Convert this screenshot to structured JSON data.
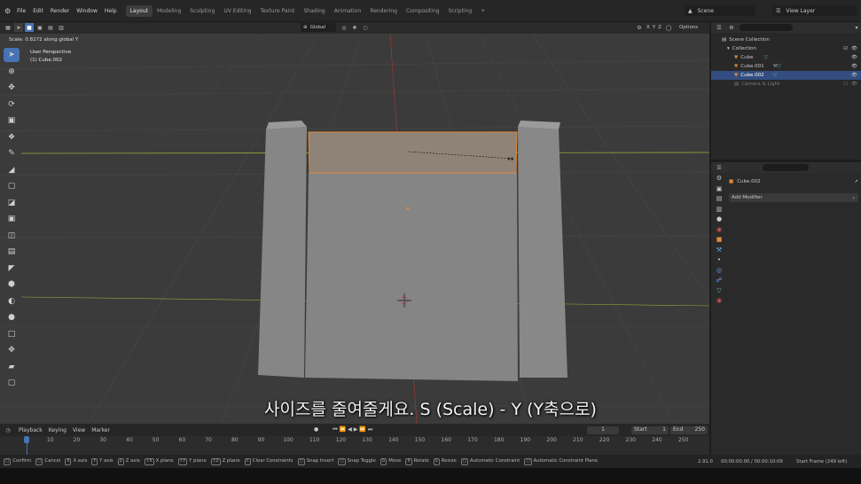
{
  "menu": {
    "items": [
      "File",
      "Edit",
      "Render",
      "Window",
      "Help"
    ],
    "workspaces": [
      "Layout",
      "Modeling",
      "Sculpting",
      "UV Editing",
      "Texture Paint",
      "Shading",
      "Animation",
      "Rendering",
      "Compositing",
      "Scripting"
    ],
    "active_workspace": "Layout",
    "plus": "+",
    "scene_label": "Scene",
    "view_layer_label": "View Layer"
  },
  "header": {
    "scale_info": "Scale: 0.8272 along global Y",
    "orientation": "Global",
    "axes": [
      "X",
      "Y",
      "Z"
    ],
    "options": "Options"
  },
  "viewport": {
    "view_name": "User Perspective",
    "object_name": "(1) Cube.002"
  },
  "subtitle": "사이즈를 줄여줄게요. S (Scale) - Y (Y축으로)",
  "outliner": {
    "root": "Scene Collection",
    "collection": "Collection",
    "objects": [
      "Cube",
      "Cube.001",
      "Cube.002"
    ],
    "selected": "Cube.002",
    "extra": "Camera & Light"
  },
  "properties": {
    "object_name": "Cube.002",
    "add_modifier": "Add Modifier"
  },
  "timeline": {
    "menu": [
      "Playback",
      "Keying",
      "View",
      "Marker"
    ],
    "current_frame": "1",
    "start_label": "Start",
    "start": "1",
    "end_label": "End",
    "end": "250",
    "ticks": [
      "1",
      "10",
      "20",
      "30",
      "40",
      "50",
      "60",
      "70",
      "80",
      "90",
      "100",
      "110",
      "120",
      "130",
      "140",
      "150",
      "160",
      "170",
      "180",
      "190",
      "200",
      "210",
      "220",
      "230",
      "240",
      "250"
    ]
  },
  "statusbar": {
    "items": [
      {
        "key": "",
        "label": "Confirm"
      },
      {
        "key": "",
        "label": "Cancel"
      },
      {
        "key": "X",
        "label": "X axis"
      },
      {
        "key": "Y",
        "label": "Y axis"
      },
      {
        "key": "Z",
        "label": "Z axis"
      },
      {
        "key": "⇧X",
        "label": "X plane"
      },
      {
        "key": "⇧Y",
        "label": "Y plane"
      },
      {
        "key": "⇧Z",
        "label": "Z plane"
      },
      {
        "key": "C",
        "label": "Clear Constraints"
      },
      {
        "key": "",
        "label": "Snap Invert"
      },
      {
        "key": "",
        "label": "Snap Toggle"
      },
      {
        "key": "G",
        "label": "Move"
      },
      {
        "key": "R",
        "label": "Rotate"
      },
      {
        "key": "S",
        "label": "Resize"
      },
      {
        "key": "",
        "label": "Automatic Constraint"
      },
      {
        "key": "",
        "label": "Automatic Constraint Plane"
      }
    ],
    "version": "2.91.0",
    "time": "00:00:00:00 / 00:00:10:09",
    "frame_info": "Start Frame (249 left)"
  },
  "colors": {
    "accent": "#4772b3",
    "selection_orange": "#e08a3a",
    "viewport_bg": "#3b3b3b"
  }
}
